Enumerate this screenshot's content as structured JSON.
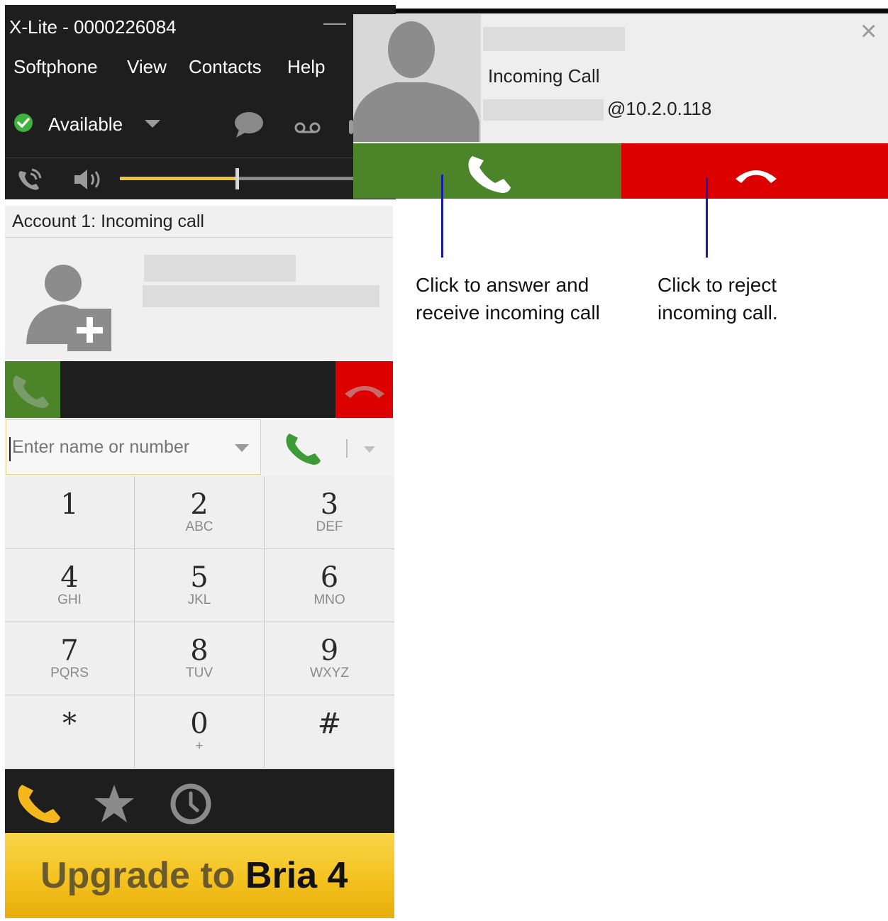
{
  "window": {
    "title": "X-Lite - 0000226084",
    "minimize_glyph": "—"
  },
  "menu": [
    "Softphone",
    "View",
    "Contacts",
    "Help"
  ],
  "status": {
    "presence_label": "Available",
    "presence_color": "#3db33d",
    "icons": [
      "chat-bubble-icon",
      "voicemail-icon",
      "call-forward-icon",
      "speaker-icon"
    ],
    "volume_level_fraction": 0.5
  },
  "account": {
    "header": "Account 1: Incoming call",
    "avatar_icon": "add-contact-icon"
  },
  "dialer": {
    "placeholder": "Enter name or number"
  },
  "keypad": [
    {
      "digit": "1",
      "letters": ""
    },
    {
      "digit": "2",
      "letters": "ABC"
    },
    {
      "digit": "3",
      "letters": "DEF"
    },
    {
      "digit": "4",
      "letters": "GHI"
    },
    {
      "digit": "5",
      "letters": "JKL"
    },
    {
      "digit": "6",
      "letters": "MNO"
    },
    {
      "digit": "7",
      "letters": "PQRS"
    },
    {
      "digit": "8",
      "letters": "TUV"
    },
    {
      "digit": "9",
      "letters": "WXYZ"
    },
    {
      "digit": "*",
      "letters": ""
    },
    {
      "digit": "0",
      "letters": "+"
    },
    {
      "digit": "#",
      "letters": ""
    }
  ],
  "bottom_nav": [
    "phone-icon",
    "favorites-star-icon",
    "history-clock-icon"
  ],
  "upgrade": {
    "prefix": "Upgrade to ",
    "brand": "Bria 4"
  },
  "popup": {
    "status": "Incoming Call",
    "address_suffix": "@10.2.0.118",
    "close_glyph": "×",
    "answer_color": "#4b8429",
    "reject_color": "#dc0000"
  },
  "annotations": {
    "answer_line1": "Click to answer and",
    "answer_line2": "receive incoming call",
    "reject_line1": "Click to reject",
    "reject_line2": "incoming call."
  }
}
